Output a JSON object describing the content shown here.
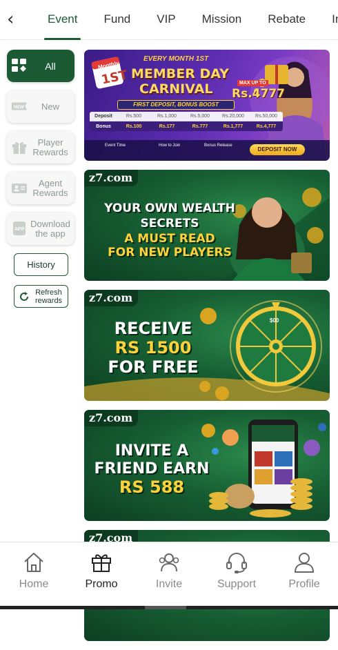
{
  "topnav": {
    "tabs": [
      {
        "label": "Event"
      },
      {
        "label": "Fund"
      },
      {
        "label": "VIP"
      },
      {
        "label": "Mission"
      },
      {
        "label": "Rebate"
      },
      {
        "label": "Int"
      }
    ]
  },
  "sidebar": {
    "items": [
      {
        "label": "All",
        "icon": "grid-icon"
      },
      {
        "label": "New",
        "icon": "new-badge-icon"
      },
      {
        "label": "Player Rewards",
        "icon": "gift-icon"
      },
      {
        "label": "Agent Rewards",
        "icon": "agent-icon"
      },
      {
        "label": "Download the app",
        "icon": "app-icon"
      }
    ],
    "history": "History",
    "refresh": "Refresh rewards"
  },
  "banners": {
    "b1": {
      "ribbon": "Monthly",
      "date": "1ST",
      "every": "EVERY MONTH 1ST",
      "title1": "MEMBER DAY",
      "title2": "CARNIVAL",
      "maxup": "MAX UP TO",
      "max": "Rs.4777",
      "sub": "FIRST DEPOSIT, BONUS BOOST",
      "row1": [
        "Deposit",
        "Rs.500",
        "Rs.1,000",
        "Rs.5,000",
        "Rs.20,000",
        "Rs.50,000"
      ],
      "row2": [
        "Bonus",
        "Rs.100",
        "Rs.177",
        "Rs.777",
        "Rs.1,777",
        "Rs.4,777"
      ],
      "event_time": "Event Time",
      "how": "How to Join",
      "release": "Bonus Release",
      "cta": "DEPOSIT NOW"
    },
    "b2": {
      "brand": "z7.com",
      "l1": "YOUR OWN WEALTH",
      "l2": "SECRETS",
      "l3": "A MUST READ",
      "l4": "FOR NEW PLAYERS"
    },
    "b3": {
      "brand": "z7.com",
      "l1": "RECEIVE",
      "l2": "RS 1500",
      "l3": "FOR FREE",
      "wheel": "$00"
    },
    "b4": {
      "brand": "z7.com",
      "l1": "INVITE A",
      "l2": "FRIEND EARN",
      "l3": "RS 588"
    },
    "b5": {
      "brand": "z7.com"
    }
  },
  "bottomnav": {
    "items": [
      {
        "label": "Home",
        "icon": "home-icon"
      },
      {
        "label": "Promo",
        "icon": "gift-icon"
      },
      {
        "label": "Invite",
        "icon": "invite-icon"
      },
      {
        "label": "Support",
        "icon": "headset-icon"
      },
      {
        "label": "Profile",
        "icon": "user-icon"
      }
    ]
  },
  "colors": {
    "brand_green": "#1c5a34",
    "gold": "#ffd23c",
    "purple": "#5a2cb0"
  }
}
